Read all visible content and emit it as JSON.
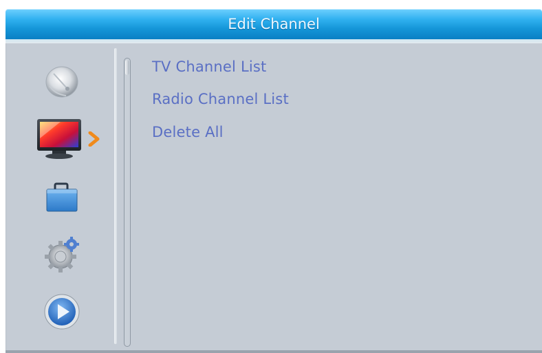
{
  "header": {
    "title": "Edit Channel"
  },
  "sidebar": {
    "items": [
      {
        "icon": "satellite-dish-icon",
        "selected": false
      },
      {
        "icon": "tv-icon",
        "selected": true
      },
      {
        "icon": "toolbox-icon",
        "selected": false
      },
      {
        "icon": "gear-icon",
        "selected": false
      },
      {
        "icon": "play-icon",
        "selected": false
      }
    ],
    "selection_indicator_icon": "chevron-right-icon"
  },
  "menu": {
    "items": [
      {
        "label": "TV Channel List"
      },
      {
        "label": "Radio Channel List"
      },
      {
        "label": "Delete All"
      }
    ]
  },
  "colors": {
    "title_bar": "#1596d8",
    "panel_background": "#c5ccd5",
    "menu_text": "#5a6fc4",
    "indicator": "#f08a1c"
  }
}
